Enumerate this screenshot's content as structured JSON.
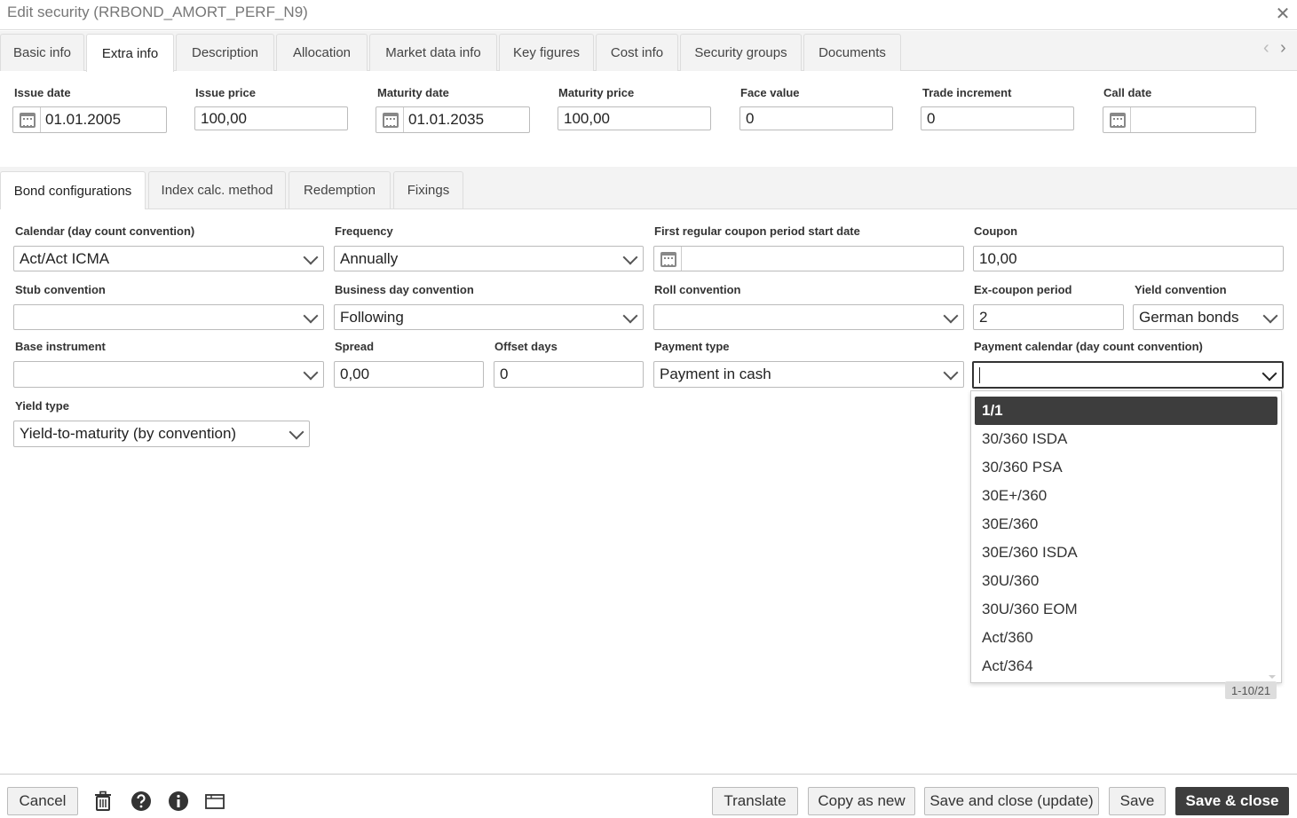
{
  "window": {
    "title": "Edit security (RRBOND_AMORT_PERF_N9)",
    "close_glyph": "✕"
  },
  "tabs": [
    {
      "label": "Basic info"
    },
    {
      "label": "Extra info"
    },
    {
      "label": "Description"
    },
    {
      "label": "Allocation"
    },
    {
      "label": "Market data info"
    },
    {
      "label": "Key figures"
    },
    {
      "label": "Cost info"
    },
    {
      "label": "Security groups"
    },
    {
      "label": "Documents"
    }
  ],
  "active_tab": "Extra info",
  "tab_nav": {
    "prev_glyph": "‹",
    "next_glyph": "›"
  },
  "top_fields": {
    "issue_date": {
      "label": "Issue date",
      "value": "01.01.2005"
    },
    "issue_price": {
      "label": "Issue price",
      "value": "100,00"
    },
    "maturity_date": {
      "label": "Maturity date",
      "value": "01.01.2035"
    },
    "maturity_price": {
      "label": "Maturity price",
      "value": "100,00"
    },
    "face_value": {
      "label": "Face value",
      "value": "0"
    },
    "trade_increment": {
      "label": "Trade increment",
      "value": "0"
    },
    "call_date": {
      "label": "Call date",
      "value": ""
    }
  },
  "subtabs": [
    {
      "label": "Bond configurations"
    },
    {
      "label": "Index calc. method"
    },
    {
      "label": "Redemption"
    },
    {
      "label": "Fixings"
    }
  ],
  "active_subtab": "Bond configurations",
  "bond": {
    "calendar": {
      "label": "Calendar (day count convention)",
      "value": "Act/Act ICMA"
    },
    "frequency": {
      "label": "Frequency",
      "value": "Annually"
    },
    "first_regular": {
      "label": "First regular coupon period start date",
      "value": ""
    },
    "coupon": {
      "label": "Coupon",
      "value": "10,00"
    },
    "stub": {
      "label": "Stub convention",
      "value": ""
    },
    "business_day": {
      "label": "Business day convention",
      "value": "Following"
    },
    "roll": {
      "label": "Roll convention",
      "value": ""
    },
    "ex_coupon": {
      "label": "Ex-coupon period",
      "value": "2"
    },
    "yield_convention": {
      "label": "Yield convention",
      "value": "German bonds"
    },
    "base_instrument": {
      "label": "Base instrument",
      "value": ""
    },
    "spread": {
      "label": "Spread",
      "value": "0,00"
    },
    "offset_days": {
      "label": "Offset days",
      "value": "0"
    },
    "payment_type": {
      "label": "Payment type",
      "value": "Payment in cash"
    },
    "payment_calendar": {
      "label": "Payment calendar (day count convention)",
      "value": ""
    },
    "yield_type": {
      "label": "Yield type",
      "value": "Yield-to-maturity (by convention)"
    }
  },
  "dropdown": {
    "options": [
      "1/1",
      "30/360 ISDA",
      "30/360 PSA",
      "30E+/360",
      "30E/360",
      "30E/360 ISDA",
      "30U/360",
      "30U/360 EOM",
      "Act/360",
      "Act/364"
    ],
    "highlighted": "1/1",
    "pager": "1-10/21"
  },
  "footer": {
    "cancel": "Cancel",
    "translate": "Translate",
    "copy_as_new": "Copy as new",
    "save_close_update": "Save and close (update)",
    "save": "Save",
    "save_close": "Save & close"
  }
}
